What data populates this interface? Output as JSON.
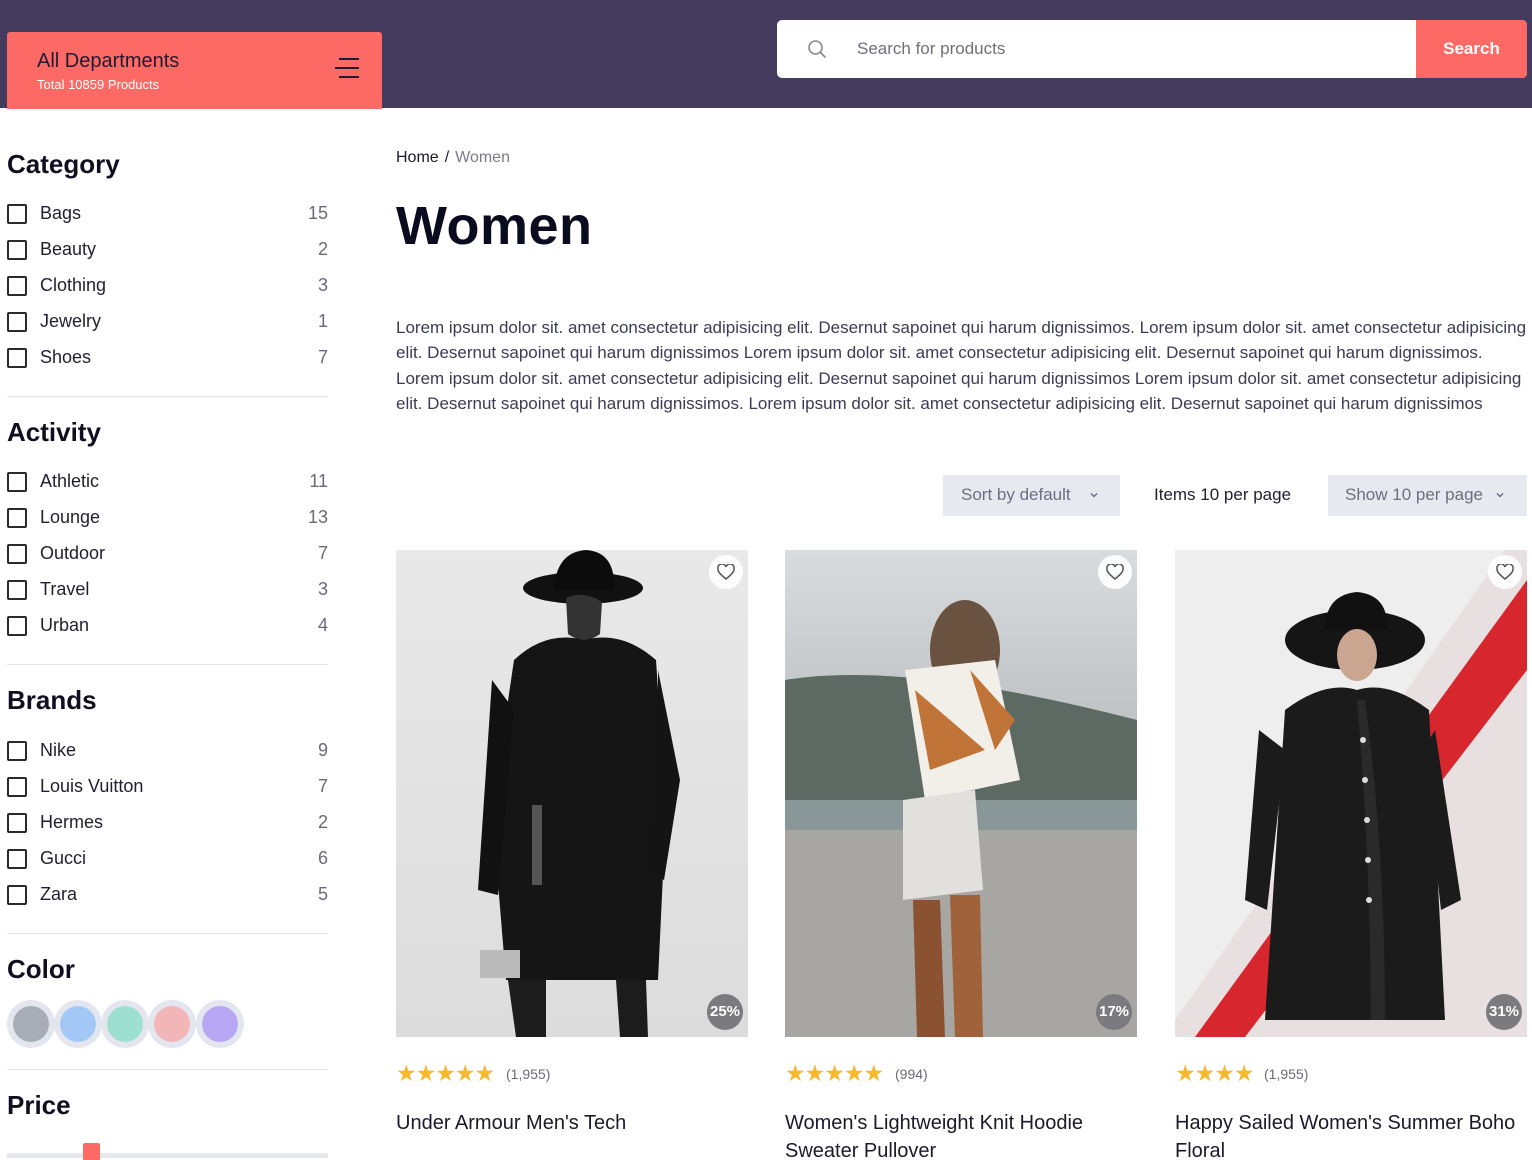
{
  "header": {
    "departments_title": "All Departments",
    "departments_subtitle": "Total 10859 Products",
    "search_placeholder": "Search for products",
    "search_button": "Search"
  },
  "sidebar": {
    "category": {
      "title": "Category",
      "items": [
        {
          "label": "Bags",
          "count": "15"
        },
        {
          "label": "Beauty",
          "count": "2"
        },
        {
          "label": "Clothing",
          "count": "3"
        },
        {
          "label": "Jewelry",
          "count": "1"
        },
        {
          "label": "Shoes",
          "count": "7"
        }
      ]
    },
    "activity": {
      "title": "Activity",
      "items": [
        {
          "label": "Athletic",
          "count": "11"
        },
        {
          "label": "Lounge",
          "count": "13"
        },
        {
          "label": "Outdoor",
          "count": "7"
        },
        {
          "label": "Travel",
          "count": "3"
        },
        {
          "label": "Urban",
          "count": "4"
        }
      ]
    },
    "brands": {
      "title": "Brands",
      "items": [
        {
          "label": "Nike",
          "count": "9"
        },
        {
          "label": "Louis Vuitton",
          "count": "7"
        },
        {
          "label": "Hermes",
          "count": "2"
        },
        {
          "label": "Gucci",
          "count": "6"
        },
        {
          "label": "Zara",
          "count": "5"
        }
      ]
    },
    "color": {
      "title": "Color",
      "swatches": [
        "#a9adb6",
        "#a4c8f5",
        "#9ee0cf",
        "#f2b5b8",
        "#b7a6f3"
      ]
    },
    "price": {
      "title": "Price"
    }
  },
  "breadcrumb": {
    "home": "Home",
    "separator": "/",
    "current": "Women"
  },
  "page": {
    "title": "Women",
    "description": "Lorem ipsum dolor sit. amet consectetur adipisicing elit. Desernut sapoinet qui harum dignissimos. Lorem ipsum dolor sit. amet consectetur adipisicing elit. Desernut sapoinet qui harum dignissimos Lorem ipsum dolor sit. amet consectetur adipisicing elit. Desernut sapoinet qui harum dignissimos. Lorem ipsum dolor sit. amet consectetur adipisicing elit. Desernut sapoinet qui harum dignissimos Lorem ipsum dolor sit. amet consectetur adipisicing elit. Desernut sapoinet qui harum dignissimos. Lorem ipsum dolor sit. amet consectetur adipisicing elit. Desernut sapoinet qui harum dignissimos"
  },
  "toolbar": {
    "sort_label": "Sort by default",
    "items_label": "Items 10 per page",
    "show_label": "Show 10 per page"
  },
  "products": [
    {
      "name": "Under Armour Men's Tech",
      "discount": "25%",
      "stars": "★★★★★",
      "reviews": "(1,955)"
    },
    {
      "name": "Women's Lightweight Knit Hoodie Sweater Pullover",
      "discount": "17%",
      "stars": "★★★★★",
      "reviews": "(994)"
    },
    {
      "name": "Happy Sailed Women's Summer Boho Floral",
      "discount": "31%",
      "stars": "★★★★",
      "reviews": "(1,955)"
    }
  ],
  "colors": {
    "header_bg": "#453b5e",
    "accent": "#fd6a66",
    "star": "#f5b82e"
  }
}
